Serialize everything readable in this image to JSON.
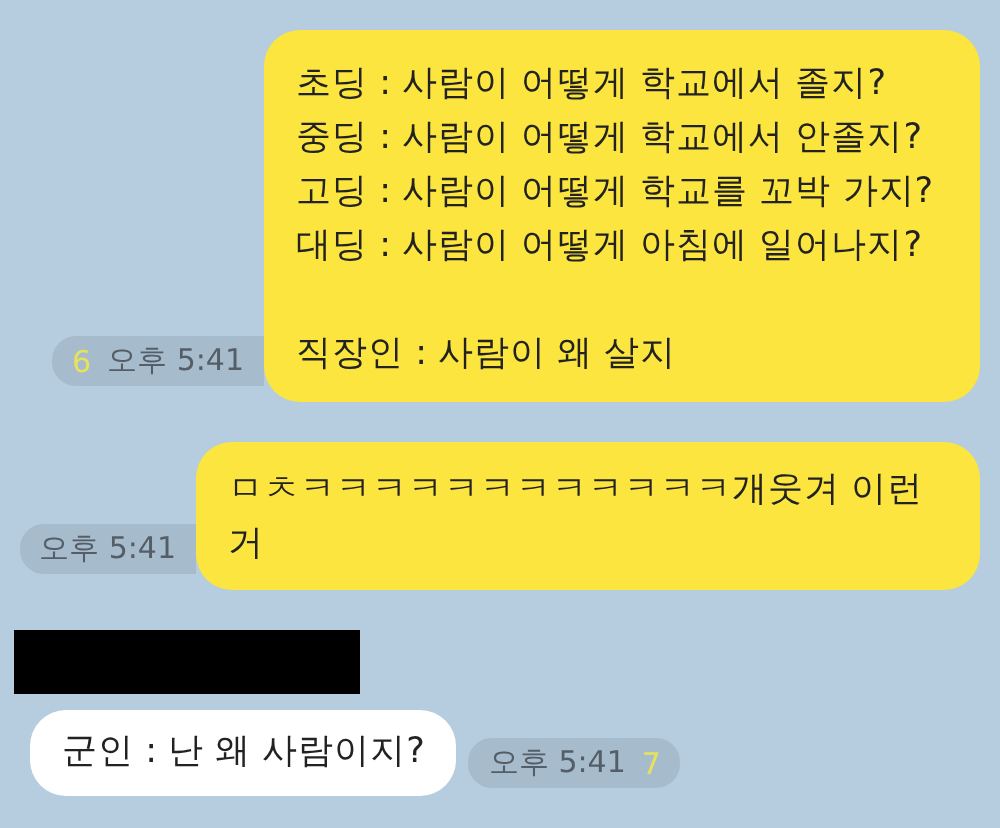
{
  "messages": [
    {
      "kind": "sent",
      "text": "초딩 : 사람이 어떻게 학교에서 졸지?\n중딩 : 사람이 어떻게 학교에서 안졸지?\n고딩 : 사람이 어떻게 학교를 꼬박 가지?\n대딩 : 사람이 어떻게 아침에 일어나지?\n\n직장인 : 사람이 왜 살지",
      "time": "오후 5:41",
      "unread": "6"
    },
    {
      "kind": "sent",
      "text": "ㅁㅊㅋㅋㅋㅋㅋㅋㅋㅋㅋㅋㅋㅋ개웃겨 이런\n거",
      "time": "오후 5:41"
    },
    {
      "kind": "received",
      "sender_redacted": true,
      "text": "군인 : 난 왜 사람이지?",
      "time": "오후 5:41",
      "unread": "7"
    }
  ]
}
